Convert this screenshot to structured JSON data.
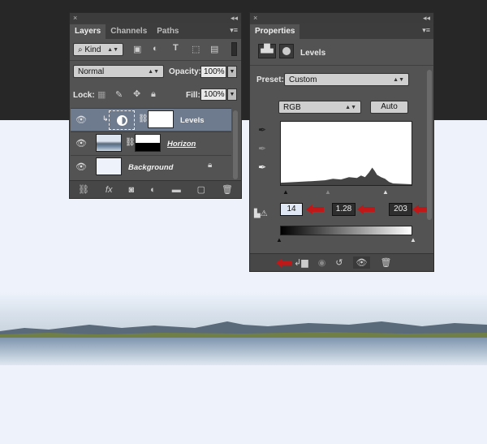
{
  "layers_panel": {
    "tabs": [
      "Layers",
      "Channels",
      "Paths"
    ],
    "filter_kind": "Kind",
    "blend_mode": "Normal",
    "opacity_label": "Opacity:",
    "opacity_value": "100%",
    "lock_label": "Lock:",
    "fill_label": "Fill:",
    "fill_value": "100%",
    "layers": [
      {
        "name": "Levels"
      },
      {
        "name": "Horizon"
      },
      {
        "name": "Background"
      }
    ]
  },
  "properties_panel": {
    "tab": "Properties",
    "title": "Levels",
    "preset_label": "Preset:",
    "preset_value": "Custom",
    "channel": "RGB",
    "auto_label": "Auto",
    "input_black": "14",
    "input_gamma": "1.28",
    "input_white": "203"
  },
  "colors": {
    "annotation_arrow": "#c01818",
    "panel_bg": "#535353",
    "selected_layer": "#6e7b8e"
  }
}
